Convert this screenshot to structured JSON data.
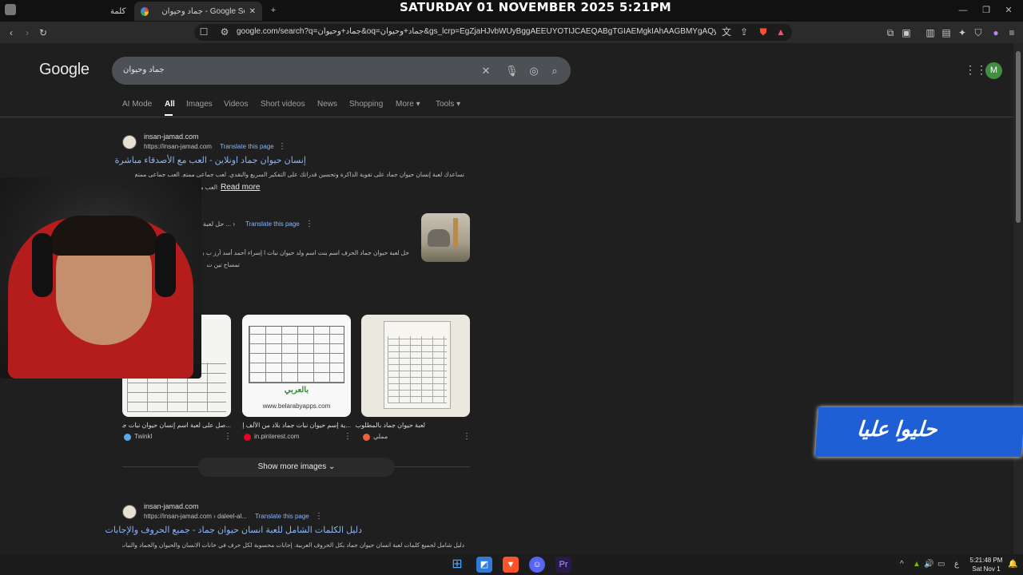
{
  "window": {
    "tabs": [
      {
        "label": "كلمة",
        "active": false
      },
      {
        "label": "جماد وحيوان - Google Search",
        "active": true
      }
    ],
    "new_tab_icon": "plus-icon",
    "overlay_datetime": "SATURDAY 01 NOVEMBER 2025 5:21PM"
  },
  "toolbar": {
    "url": "google.com/search?q=جماد+وحيوان&oq=جماد+وحيوان&gs_lcrp=EgZjaHJvbWUyBggAEEUYOTIJCAEQABgTGIAEMgkIAhAAGBMYgAQyCQgDEAA..."
  },
  "google": {
    "logo": "Google",
    "query": "جماد وحيوان",
    "avatar_letter": "M",
    "nav_tabs": [
      "AI Mode",
      "All",
      "Images",
      "Videos",
      "Short videos",
      "News",
      "Shopping",
      "More",
      "Tools"
    ],
    "active_tab": "All"
  },
  "results": [
    {
      "site": "insan-jamad.com",
      "url": "https://insan-jamad.com",
      "translate": "Translate this page",
      "title": "إنسان حيوان جماد اونلاين - العب مع الأصدقاء مباشرة",
      "snippet": "تساعدك لعبة إنسان حيوان جماد على تقوية الذاكرة وتحسين قدراتك على التفكير السريع والنقدي. لعب جماعي ممتع. العب جماعي ممتع",
      "snippet2": "العب مع أصدقائك",
      "read_more": "Read more"
    },
    {
      "url": "حل لعبة ... ›",
      "translate": "Translate this page",
      "snippet": "حل لعبة حيوان جماد الحرف اسم بنت اسم ولد حيوان نبات ا إسراء أحمد أسد أرز ب بسمة",
      "snippet2": "تمساح تين ت"
    },
    {
      "site": "insan-jamad.com",
      "url": "https://insan-jamad.com › daleel-al...",
      "translate": "Translate this page",
      "title": "دليل الكلمات الشامل للعبة انسان حيوان جماد - جميع الحروف والإجابات",
      "snippet": "دليل شامل لجميع كلمات لعبة انسان حيوان جماد بكل الحروف العربية. إجابات محسوبة لكل حرف في خانات الانسان والحيوان والجماد والنبات"
    }
  ],
  "images": [
    {
      "caption": "...صل على لعبة اسم إنسان حيوان نبات جماد",
      "source": "Twinkl"
    },
    {
      "caption": "...ية إسم حيوان نبات جماد بلاد من الألف إلى",
      "source": "in.pinterest.com",
      "watermark": "www.belarabyapps.com",
      "brand": "بالعربي"
    },
    {
      "caption": "لعبة حيوان جماد بالمطلوب",
      "source": "مملي"
    }
  ],
  "show_more_images": "Show more images",
  "banner": {
    "text": "حليوا عليا"
  },
  "taskbar": {
    "time": "5:21:48 PM",
    "date": "Sat Nov 1",
    "lang": "ع"
  }
}
